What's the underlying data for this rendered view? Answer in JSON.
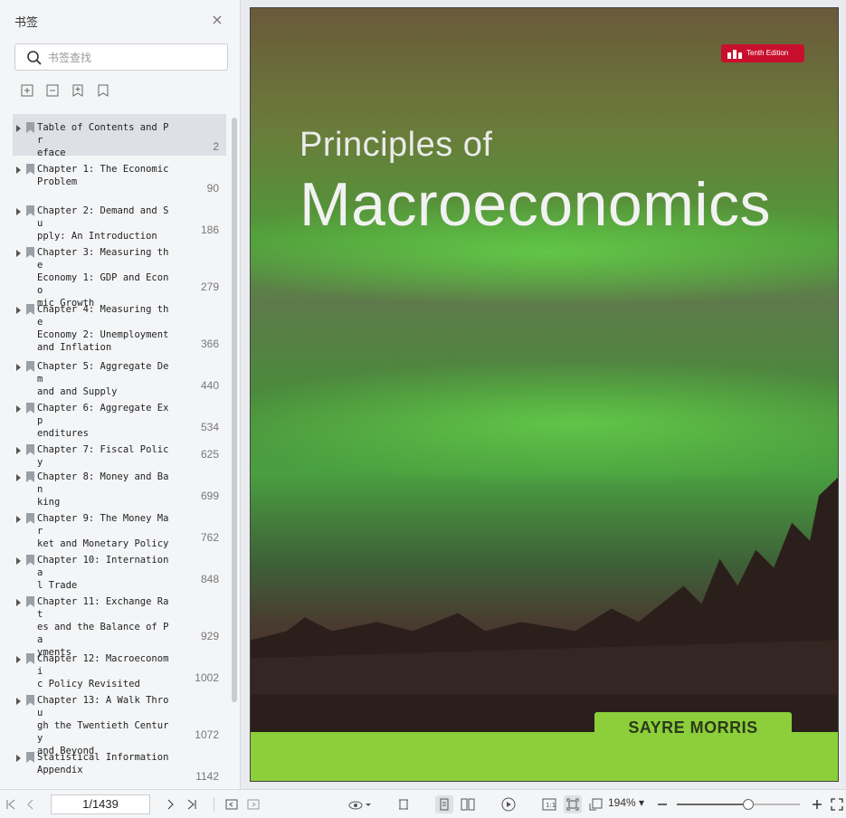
{
  "sidebar": {
    "title": "书签",
    "search_placeholder": "书签查找",
    "bookmarks": [
      {
        "title": "Table of Contents and Pr\neface",
        "page": "2"
      },
      {
        "title": "Chapter 1: The Economic\nProblem",
        "page": "90"
      },
      {
        "title": "Chapter 2: Demand and Su\npply: An Introduction",
        "page": "186"
      },
      {
        "title": "Chapter 3: Measuring the\nEconomy 1: GDP and Econo\nmic Growth",
        "page": "279"
      },
      {
        "title": "Chapter 4: Measuring the\nEconomy 2: Unemployment\nand Inflation",
        "page": "366"
      },
      {
        "title": "Chapter 5: Aggregate Dem\nand and Supply",
        "page": "440"
      },
      {
        "title": "Chapter 6: Aggregate Exp\nenditures",
        "page": "534"
      },
      {
        "title": "Chapter 7: Fiscal Policy",
        "page": "625"
      },
      {
        "title": "Chapter 8: Money and Ban\nking",
        "page": "699"
      },
      {
        "title": "Chapter 9: The Money Mar\nket and Monetary Policy",
        "page": "762"
      },
      {
        "title": "Chapter 10: Internationa\nl Trade",
        "page": "848"
      },
      {
        "title": "Chapter 11: Exchange Rat\nes and the Balance of Pa\nyments",
        "page": "929"
      },
      {
        "title": "Chapter 12: Macroeconomi\nc Policy Revisited",
        "page": "1002"
      },
      {
        "title": "Chapter 13: A Walk Throu\ngh the Twentieth Century\nand Beyond",
        "page": "1072"
      },
      {
        "title": "Statistical Information\nAppendix",
        "page": "1142"
      }
    ]
  },
  "cover": {
    "edition": "Tenth Edition",
    "title_line1": "Principles of",
    "title_line2": "Macroeconomics",
    "authors": "SAYRE   MORRIS"
  },
  "statusbar": {
    "page_indicator": "1/1439",
    "zoom": "194%",
    "zoom_level": 0.58
  }
}
